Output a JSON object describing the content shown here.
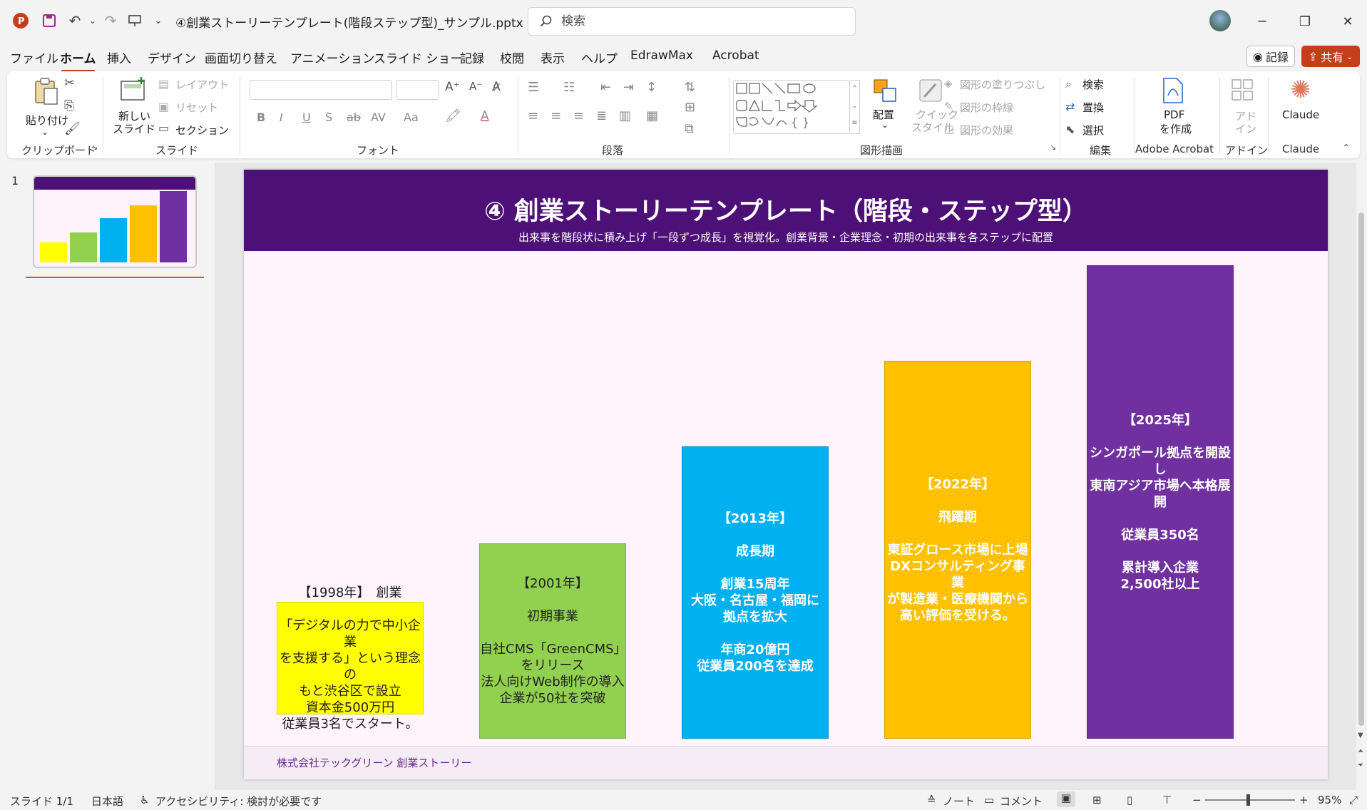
{
  "titlebar": {
    "doc_title": "④創業ストーリーテンプレート(階段ステップ型)_サンプル.pptx  -  PowerP…",
    "search_placeholder": "検索"
  },
  "menu": {
    "tabs": [
      "ファイル",
      "ホーム",
      "挿入",
      "デザイン",
      "画面切り替え",
      "アニメーション",
      "スライド ショー",
      "記録",
      "校閲",
      "表示",
      "ヘルプ",
      "EdrawMax",
      "Acrobat"
    ],
    "active_index": 1,
    "record_label": "記録",
    "share_label": "共有"
  },
  "ribbon": {
    "clipboard": {
      "paste": "貼り付け",
      "label": "クリップボード"
    },
    "slides": {
      "new_slide_line1": "新しい",
      "new_slide_line2": "スライド",
      "layout": "レイアウト",
      "reset": "リセット",
      "section": "セクション",
      "label": "スライド"
    },
    "font": {
      "label": "フォント"
    },
    "paragraph": {
      "label": "段落"
    },
    "drawing": {
      "arrange": "配置",
      "quick_style_line1": "クイック",
      "quick_style_line2": "スタイル",
      "fill": "図形の塗りつぶし",
      "outline": "図形の枠線",
      "effects": "図形の効果",
      "label": "図形描画"
    },
    "editing": {
      "find": "検索",
      "replace": "置換",
      "select": "選択",
      "label": "編集"
    },
    "acrobat": {
      "pdf_line1": "PDF",
      "pdf_line2": "を作成",
      "label": "Adobe Acrobat"
    },
    "addins": {
      "addin_line1": "アド",
      "addin_line2": "イン",
      "label": "アドイン"
    },
    "claude": {
      "button": "Claude",
      "label": "Claude"
    }
  },
  "slidepane": {
    "slide_number": "1"
  },
  "slide": {
    "title": "④ 創業ストーリーテンプレート（階段・ステップ型）",
    "subtitle": "出来事を階段状に積み上げ「一段ずつ成長」を視覚化。創業背景・企業理念・初期の出来事を各ステップに配置",
    "footer": "株式会社テックグリーン 創業ストーリー",
    "steps": [
      {
        "color": "#ffff00",
        "text_color": "#1f1f1f",
        "bold": false,
        "lines": [
          "【1998年】　創業",
          "",
          "「デジタルの力で中小企業",
          "を支援する」という理念の",
          "もと渋谷区で設立",
          "資本金500万円",
          "従業員3名でスタート。"
        ]
      },
      {
        "color": "#92d050",
        "text_color": "#1f1f1f",
        "bold": false,
        "lines": [
          "【2001年】",
          "",
          "初期事業",
          "",
          "自社CMS「GreenCMS」",
          "をリリース",
          "法人向けWeb制作の導入",
          "企業が50社を突破"
        ]
      },
      {
        "color": "#00b0f0",
        "text_color": "#ffffff",
        "bold": true,
        "lines": [
          "【2013年】",
          "",
          "成長期",
          "",
          "創業15周年",
          "大阪・名古屋・福岡に",
          "拠点を拡大",
          "",
          "年商20億円",
          "従業員200名を達成"
        ]
      },
      {
        "color": "#ffc000",
        "text_color": "#ffffff",
        "bold": true,
        "lines": [
          "【2022年】",
          "",
          "飛躍期",
          "",
          "東証グロース市場に上場",
          "DXコンサルティング事業",
          "が製造業・医療機関から",
          "高い評価を受ける。"
        ]
      },
      {
        "color": "#7030a0",
        "text_color": "#ffffff",
        "bold": true,
        "lines": [
          "【2025年】",
          "",
          "シンガポール拠点を開設し",
          "東南アジア市場へ本格展開",
          "",
          "従業員350名",
          "",
          "累計導入企業",
          "2,500社以上"
        ]
      }
    ]
  },
  "statusbar": {
    "slide_info": "スライド 1/1",
    "language": "日本語",
    "accessibility": "アクセシビリティ: 検討が必要です",
    "notes": "ノート",
    "comments": "コメント",
    "zoom": "95%"
  }
}
